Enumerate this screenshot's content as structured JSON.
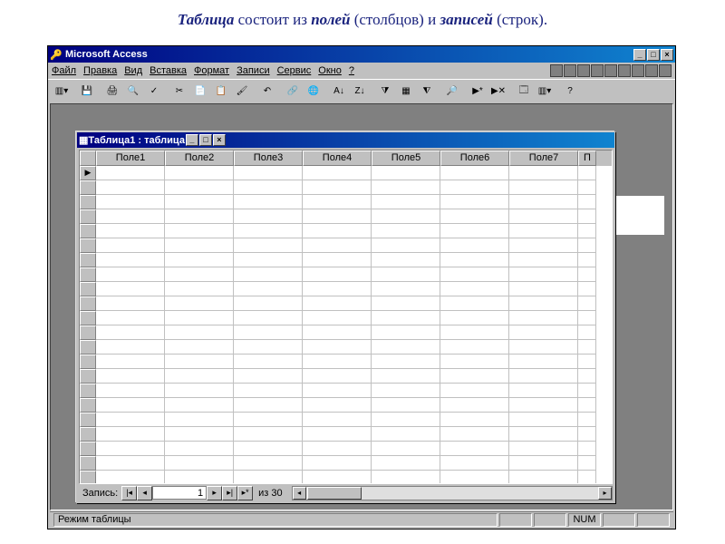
{
  "caption": {
    "w1": "Таблица",
    "t1": " состоит из ",
    "w2": "полей",
    "t2": " (столбцов) и ",
    "w3": "записей",
    "t3": " (строк)."
  },
  "app": {
    "title": "Microsoft Access",
    "menus": [
      "Файл",
      "Правка",
      "Вид",
      "Вставка",
      "Формат",
      "Записи",
      "Сервис",
      "Окно",
      "?"
    ],
    "status_mode": "Режим таблицы",
    "status_num": "NUM"
  },
  "child": {
    "title": "Таблица1 : таблица",
    "columns": [
      "Поле1",
      "Поле2",
      "Поле3",
      "Поле4",
      "Поле5",
      "Поле6",
      "Поле7"
    ],
    "last_col": "П",
    "nav_label": "Запись:",
    "nav_current": "1",
    "nav_total_prefix": "из",
    "nav_total": "30",
    "first_row_marker": "▶"
  }
}
